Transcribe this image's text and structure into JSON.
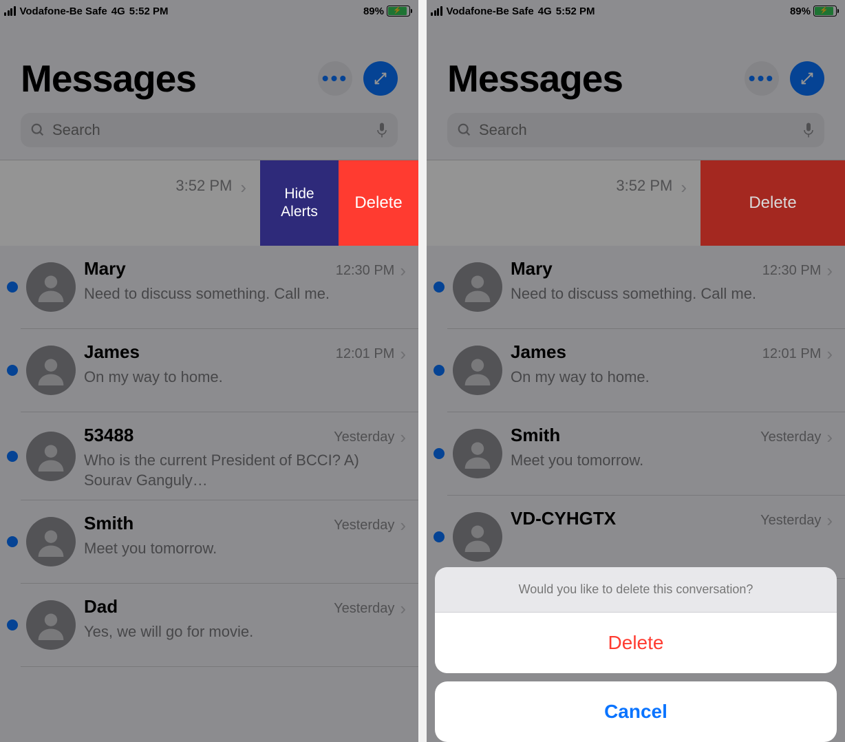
{
  "status_bar": {
    "carrier": "Vodafone-Be Safe",
    "network": "4G",
    "time": "5:52 PM",
    "battery_pct": "89%"
  },
  "header": {
    "title": "Messages"
  },
  "search": {
    "placeholder": "Search"
  },
  "swipe": {
    "visible_time": "3:52 PM",
    "hide_label": "Hide\nAlerts",
    "delete_label": "Delete"
  },
  "left_messages": [
    {
      "name": "Mary",
      "time": "12:30 PM",
      "preview": "Need to discuss something. Call me.",
      "unread": true
    },
    {
      "name": "James",
      "time": "12:01 PM",
      "preview": "On my way to home.",
      "unread": true
    },
    {
      "name": "53488",
      "time": "Yesterday",
      "preview": "Who is the current President of BCCI? A) Sourav Ganguly…",
      "unread": true
    },
    {
      "name": "Smith",
      "time": "Yesterday",
      "preview": "Meet you tomorrow.",
      "unread": true
    },
    {
      "name": "Dad",
      "time": "Yesterday",
      "preview": "Yes, we will go for movie.",
      "unread": true
    }
  ],
  "right_messages": [
    {
      "name": "Mary",
      "time": "12:30 PM",
      "preview": "Need to discuss something. Call me.",
      "unread": true
    },
    {
      "name": "James",
      "time": "12:01 PM",
      "preview": "On my way to home.",
      "unread": true
    },
    {
      "name": "Smith",
      "time": "Yesterday",
      "preview": "Meet you tomorrow.",
      "unread": true
    },
    {
      "name": "VD-CYHGTX",
      "time": "Yesterday",
      "preview": "",
      "unread": true
    }
  ],
  "sheet": {
    "prompt": "Would you like to delete this conversation?",
    "delete_label": "Delete",
    "cancel_label": "Cancel"
  }
}
